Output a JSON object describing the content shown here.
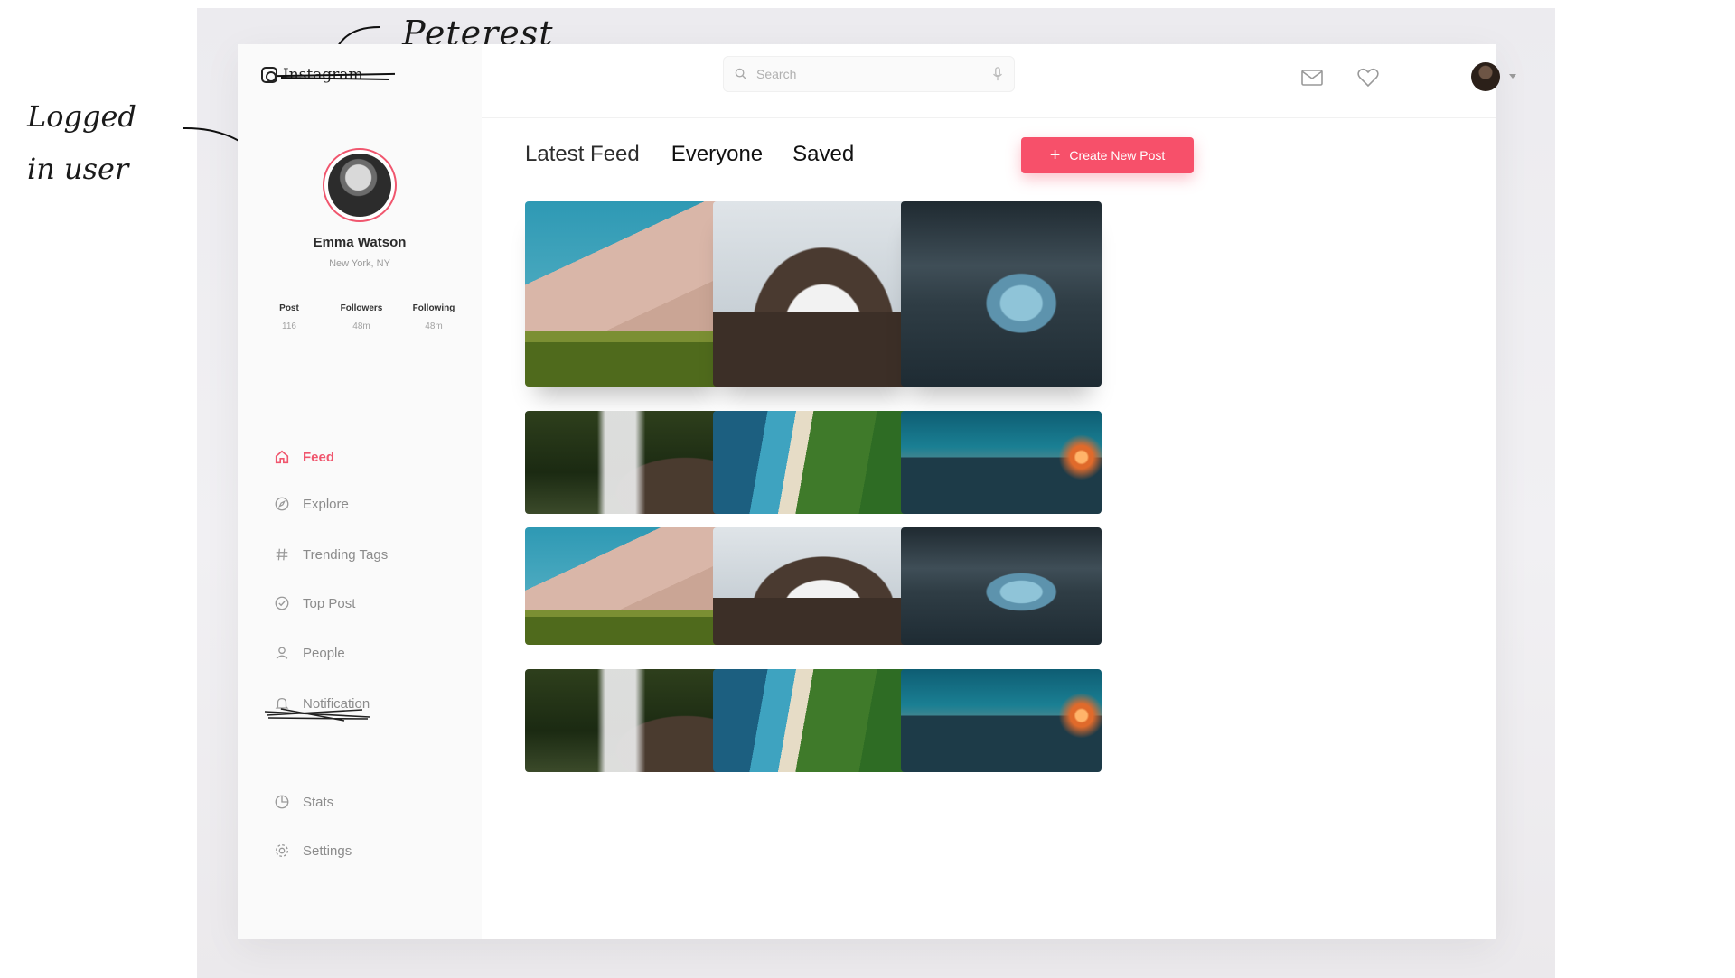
{
  "annotations": {
    "title": "Peterest",
    "user_note": "Logged in user"
  },
  "app": {
    "logo_text": "Instagram"
  },
  "search": {
    "placeholder": "Search"
  },
  "user": {
    "name": "Emma Watson",
    "location": "New York, NY",
    "stats": [
      {
        "label": "Post",
        "value": "116"
      },
      {
        "label": "Followers",
        "value": "48m"
      },
      {
        "label": "Following",
        "value": "48m"
      }
    ]
  },
  "sidebar": {
    "items": [
      {
        "label": "Feed",
        "icon": "home-icon",
        "active": true
      },
      {
        "label": "Explore",
        "icon": "compass-icon"
      },
      {
        "label": "Trending Tags",
        "icon": "hashtag-icon"
      },
      {
        "label": "Top Post",
        "icon": "check-circle-icon"
      },
      {
        "label": "People",
        "icon": "person-icon"
      },
      {
        "label": "Notification",
        "icon": "bell-icon"
      },
      {
        "label": "Stats",
        "icon": "pie-chart-icon"
      },
      {
        "label": "Settings",
        "icon": "gear-icon"
      }
    ]
  },
  "feed": {
    "title": "Latest Feed",
    "tabs": [
      "Everyone",
      "Saved"
    ],
    "create_label": "Create New Post",
    "posts": [
      {
        "scene": "desert-dune"
      },
      {
        "scene": "snowy-mountain"
      },
      {
        "scene": "iceberg-sea"
      },
      {
        "scene": "waterfall"
      },
      {
        "scene": "aerial-coast"
      },
      {
        "scene": "half-dome-sunset"
      },
      {
        "scene": "desert-dune"
      },
      {
        "scene": "snowy-mountain"
      },
      {
        "scene": "iceberg-sea"
      },
      {
        "scene": "waterfall"
      },
      {
        "scene": "aerial-coast"
      },
      {
        "scene": "half-dome-sunset"
      }
    ]
  },
  "colors": {
    "accent": "#f7506a",
    "text_muted": "#8b8b8b"
  }
}
